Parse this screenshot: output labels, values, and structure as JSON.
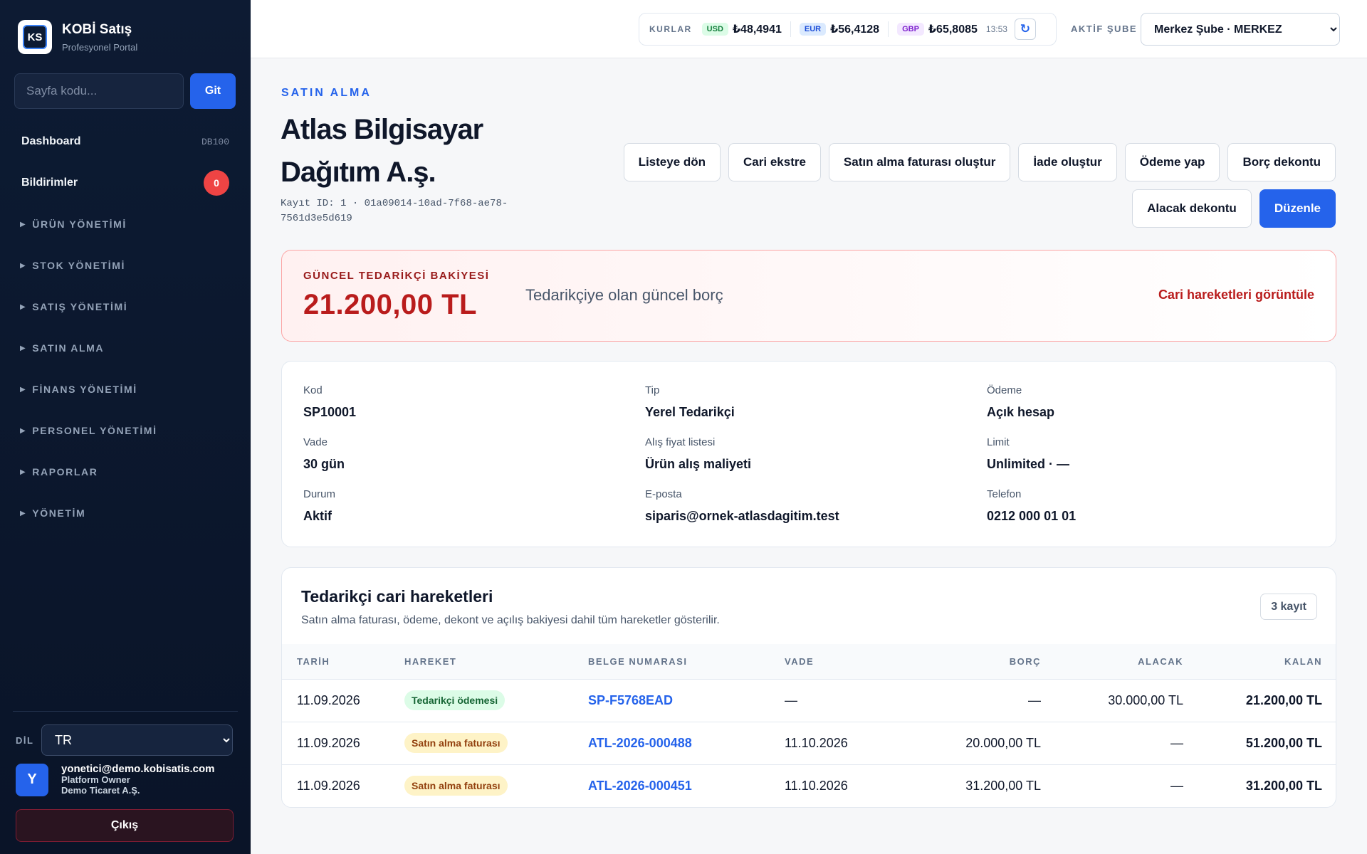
{
  "sidebar": {
    "brand_title": "KOBİ Satış",
    "brand_sub": "Profesyonel Portal",
    "logo_text": "KS",
    "search_placeholder": "Sayfa kodu...",
    "go_label": "Git",
    "dashboard_label": "Dashboard",
    "dashboard_code": "DB100",
    "notifications_label": "Bildirimler",
    "notifications_count": "0",
    "groups": [
      "ÜRÜN YÖNETİMİ",
      "STOK YÖNETİMİ",
      "SATIŞ YÖNETİMİ",
      "SATIN ALMA",
      "FİNANS YÖNETİMİ",
      "PERSONEL YÖNETİMİ",
      "RAPORLAR",
      "YÖNETİM"
    ],
    "lang_label": "DİL",
    "lang_value": "TR",
    "user_initial": "Y",
    "user_email": "yonetici@demo.kobisatis.com",
    "user_role": "Platform Owner",
    "user_company": "Demo Ticaret A.Ş.",
    "logout_label": "Çıkış"
  },
  "topbar": {
    "rates_label": "KURLAR",
    "rates": [
      {
        "code": "USD",
        "value": "₺48,4941",
        "bg": "#dcfce7",
        "fg": "#15803d"
      },
      {
        "code": "EUR",
        "value": "₺56,4128",
        "bg": "#dbeafe",
        "fg": "#1d4ed8"
      },
      {
        "code": "GBP",
        "value": "₺65,8085",
        "bg": "#f3e8ff",
        "fg": "#7e22ce"
      }
    ],
    "rate_time": "13:53",
    "refresh_icon": "refresh-icon",
    "branch_label": "AKTİF ŞUBE",
    "branch_value": "Merkez Şube · MERKEZ"
  },
  "header": {
    "eyebrow": "SATIN ALMA",
    "title": "Atlas Bilgisayar Dağıtım A.ş.",
    "record_id": "Kayıt ID: 1 · 01a09014-10ad-7f68-ae78-7561d3e5d619"
  },
  "actions": {
    "back": "Listeye dön",
    "statement": "Cari ekstre",
    "purchase_invoice": "Satın alma faturası oluştur",
    "return": "İade oluştur",
    "pay": "Ödeme yap",
    "debit_note": "Borç dekontu",
    "credit_note": "Alacak dekontu",
    "edit": "Düzenle"
  },
  "balance": {
    "label": "GÜNCEL TEDARİKÇİ BAKİYESİ",
    "amount": "21.200,00 TL",
    "description": "Tedarikçiye olan güncel borç",
    "link": "Cari hareketleri görüntüle"
  },
  "info": {
    "kod": {
      "label": "Kod",
      "value": "SP10001"
    },
    "tip": {
      "label": "Tip",
      "value": "Yerel Tedarikçi"
    },
    "odeme": {
      "label": "Ödeme",
      "value": "Açık hesap"
    },
    "vade": {
      "label": "Vade",
      "value": "30 gün"
    },
    "fiyat": {
      "label": "Alış fiyat listesi",
      "value": "Ürün alış maliyeti"
    },
    "limit": {
      "label": "Limit",
      "value": "Unlimited · —"
    },
    "durum": {
      "label": "Durum",
      "value": "Aktif"
    },
    "eposta": {
      "label": "E-posta",
      "value": "siparis@ornek-atlasdagitim.test"
    },
    "telefon": {
      "label": "Telefon",
      "value": "0212 000 01 01"
    }
  },
  "transactions": {
    "title": "Tedarikçi cari hareketleri",
    "subtitle": "Satın alma faturası, ödeme, dekont ve açılış bakiyesi dahil tüm hareketler gösterilir.",
    "count": "3 kayıt",
    "columns": {
      "date": "TARİH",
      "type": "HAREKET",
      "doc": "BELGE NUMARASI",
      "due": "VADE",
      "debit": "BORÇ",
      "credit": "ALACAK",
      "balance": "KALAN"
    },
    "rows": [
      {
        "date": "11.09.2026",
        "type": "Tedarikçi ödemesi",
        "doc": "SP-F5768EAD",
        "due": "—",
        "debit": "—",
        "credit": "30.000,00 TL",
        "balance": "21.200,00 TL"
      },
      {
        "date": "11.09.2026",
        "type": "Satın alma faturası",
        "doc": "ATL-2026-000488",
        "due": "11.10.2026",
        "debit": "20.000,00 TL",
        "credit": "—",
        "balance": "51.200,00 TL"
      },
      {
        "date": "11.09.2026",
        "type": "Satın alma faturası",
        "doc": "ATL-2026-000451",
        "due": "11.10.2026",
        "debit": "31.200,00 TL",
        "credit": "—",
        "balance": "31.200,00 TL"
      }
    ]
  }
}
